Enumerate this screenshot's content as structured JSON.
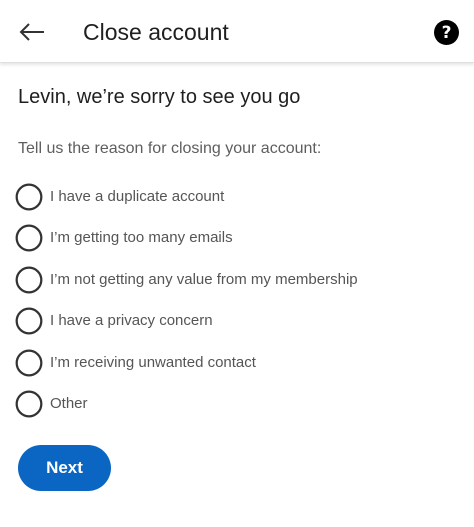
{
  "header": {
    "back_icon": "arrow-left-icon",
    "title": "Close account",
    "help_icon": "question-circle-icon",
    "help_glyph": "?"
  },
  "main": {
    "headline": "Levin, we’re sorry to see you go",
    "prompt": "Tell us the reason for closing your account:",
    "options": [
      {
        "label": "I have a duplicate account"
      },
      {
        "label": "I’m getting too many emails"
      },
      {
        "label": "I’m not getting any value from my membership"
      },
      {
        "label": "I have a privacy concern"
      },
      {
        "label": "I’m receiving unwanted contact"
      },
      {
        "label": "Other"
      }
    ],
    "next_label": "Next"
  },
  "colors": {
    "primary": "#0a66c2",
    "text": "#1f1f1f",
    "secondary_text": "#5e5e5e"
  }
}
